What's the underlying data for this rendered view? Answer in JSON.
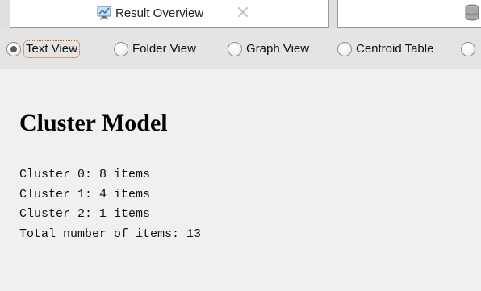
{
  "tabs": {
    "active_tab": {
      "label": "Result Overview",
      "icon": "result-overview-icon",
      "close_icon": "close-icon"
    },
    "second_tab": {
      "icon": "database-icon"
    }
  },
  "views": {
    "options": [
      {
        "label": "Text View",
        "selected": true
      },
      {
        "label": "Folder View",
        "selected": false
      },
      {
        "label": "Graph View",
        "selected": false
      },
      {
        "label": "Centroid Table",
        "selected": false
      }
    ]
  },
  "model": {
    "title": "Cluster Model",
    "lines": [
      "Cluster 0: 8 items",
      "Cluster 1: 4 items",
      "Cluster 2: 1 items",
      "Total number of items: 13"
    ]
  },
  "colors": {
    "focus_outline": "#d35400",
    "background": "#f0f0f0"
  }
}
